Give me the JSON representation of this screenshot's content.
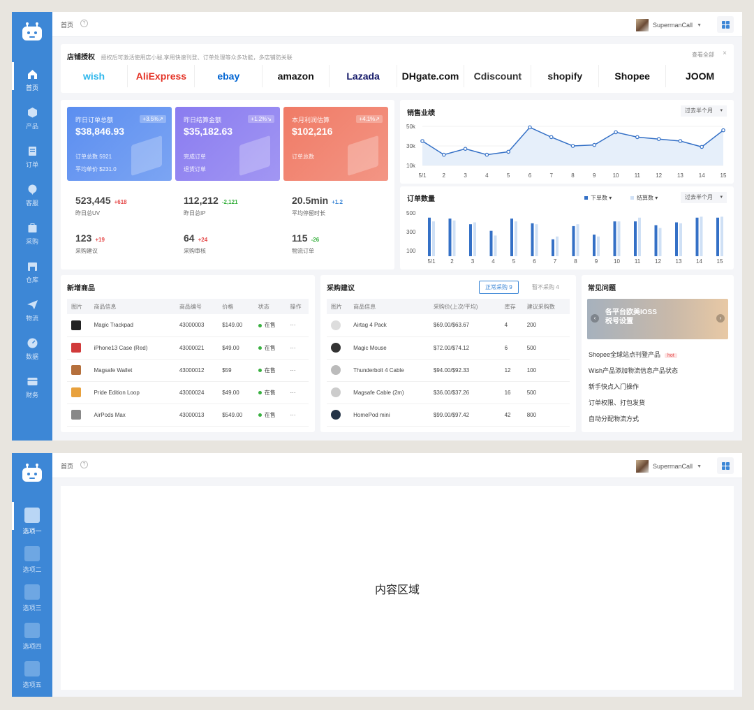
{
  "nav": [
    {
      "label": "首页",
      "icon": "home-icon"
    },
    {
      "label": "产品",
      "icon": "cube-icon"
    },
    {
      "label": "订单",
      "icon": "document-icon"
    },
    {
      "label": "客服",
      "icon": "chat-icon"
    },
    {
      "label": "采购",
      "icon": "bag-icon"
    },
    {
      "label": "仓库",
      "icon": "warehouse-icon"
    },
    {
      "label": "物流",
      "icon": "send-icon"
    },
    {
      "label": "数据",
      "icon": "gauge-icon"
    },
    {
      "label": "财务",
      "icon": "wallet-icon"
    }
  ],
  "nav2": [
    "选项一",
    "选项二",
    "选项三",
    "选项四",
    "选项五"
  ],
  "top": {
    "breadcrumb": "首页",
    "help": "?",
    "user": "SupermanCall"
  },
  "store": {
    "title": "店铺授权",
    "desc": "授权后可激活使用店小秘,享用快速刊登、订单处理等众多功能，多店铺防关联",
    "view_all": "查看全部",
    "close": "×",
    "platforms": [
      {
        "name": "wish",
        "color": "#2fb7ec"
      },
      {
        "name": "AliExpress",
        "color": "#e43225"
      },
      {
        "name": "ebay",
        "color": "#0064d2"
      },
      {
        "name": "amazon",
        "color": "#111111"
      },
      {
        "name": "Lazada",
        "color": "#101566"
      },
      {
        "name": "DHgate.com",
        "color": "#111111"
      },
      {
        "name": "Cdiscount",
        "color": "#333333"
      },
      {
        "name": "shopify",
        "color": "#222222"
      },
      {
        "name": "Shopee",
        "color": "#111111"
      },
      {
        "name": "JOOM",
        "color": "#111111"
      }
    ]
  },
  "kpis": [
    {
      "label": "昨日订单总额",
      "value": "$38,846.93",
      "badge": "+3.5%↗",
      "l1": "订单总数 5921",
      "l2": "平均单价 $231.0",
      "color": "#5b8ef0"
    },
    {
      "label": "昨日结算金额",
      "value": "$35,182.63",
      "badge": "+1.2%↘",
      "l1": "完成订单",
      "l2": "退货订单",
      "color": "#8a7cf0"
    },
    {
      "label": "本月利润估算",
      "value": "$102,216",
      "badge": "+4.1%↗",
      "l1": "订单总数",
      "l2": "",
      "color": "#f07b66"
    }
  ],
  "stats": [
    {
      "value": "523,445",
      "delta": "+618",
      "label": "昨日总UV",
      "tone": "up"
    },
    {
      "value": "112,212",
      "delta": "-2,121",
      "label": "昨日总IP",
      "tone": "down"
    },
    {
      "value": "20.5min",
      "delta": "+1.2",
      "label": "平均停留时长",
      "tone": "blue"
    },
    {
      "value": "123",
      "delta": "+19",
      "label": "采购建议",
      "tone": "up"
    },
    {
      "value": "64",
      "delta": "+24",
      "label": "采购审核",
      "tone": "up"
    },
    {
      "value": "115",
      "delta": "-26",
      "label": "物流订单",
      "tone": "down"
    }
  ],
  "sales": {
    "title": "销售业绩",
    "period": "过去半个月"
  },
  "orders": {
    "title": "订单数量",
    "period": "过去半个月",
    "legend1": "下单数",
    "legend2": "结算数"
  },
  "chart_data": [
    {
      "type": "area",
      "title": "销售业绩",
      "x": [
        "5/1",
        "2",
        "3",
        "4",
        "5",
        "6",
        "7",
        "8",
        "9",
        "10",
        "11",
        "12",
        "13",
        "14",
        "15"
      ],
      "yticks": [
        "50k",
        "30k",
        "10k"
      ],
      "ylim": [
        10000,
        50000
      ],
      "series": [
        {
          "values": [
            35000,
            21000,
            27000,
            21000,
            24000,
            49000,
            39000,
            30000,
            31000,
            44000,
            39000,
            37000,
            35000,
            29000,
            46000
          ]
        }
      ]
    },
    {
      "type": "bar",
      "title": "订单数量",
      "categories": [
        "5/1",
        "2",
        "3",
        "4",
        "5",
        "6",
        "7",
        "8",
        "9",
        "10",
        "11",
        "12",
        "13",
        "14",
        "15"
      ],
      "yticks": [
        "500",
        "300",
        "100"
      ],
      "ylim": [
        100,
        500
      ],
      "series": [
        {
          "name": "下单数",
          "values": [
            450,
            440,
            380,
            310,
            440,
            390,
            220,
            360,
            270,
            410,
            410,
            370,
            400,
            450,
            450
          ]
        },
        {
          "name": "结算数",
          "values": [
            410,
            420,
            400,
            260,
            410,
            380,
            250,
            380,
            250,
            410,
            450,
            340,
            390,
            460,
            460
          ]
        }
      ]
    }
  ],
  "newp": {
    "title": "新增商品",
    "headers": [
      "图片",
      "商品信息",
      "商品编号",
      "价格",
      "状态",
      "操作"
    ],
    "rows": [
      {
        "name": "Magic Trackpad",
        "code": "43000003",
        "price": "$149.00",
        "status": "在售",
        "op": "···",
        "thumb": "#222"
      },
      {
        "name": "iPhone13 Case (Red)",
        "code": "43000021",
        "price": "$49.00",
        "status": "在售",
        "op": "···",
        "thumb": "#d13a3a"
      },
      {
        "name": "Magsafe Wallet",
        "code": "43000012",
        "price": "$59",
        "status": "在售",
        "op": "···",
        "thumb": "#b5703c"
      },
      {
        "name": "Pride Edition Loop",
        "code": "43000024",
        "price": "$49.00",
        "status": "在售",
        "op": "···",
        "thumb": "#e8a13d"
      },
      {
        "name": "AirPods Max",
        "code": "43000013",
        "price": "$549.00",
        "status": "在售",
        "op": "···",
        "thumb": "#888"
      }
    ]
  },
  "buy": {
    "title": "采购建议",
    "tab1": "正常采购 9",
    "tab2": "暂不采购 4",
    "headers": [
      "图片",
      "商品信息",
      "采购价(上次/平均)",
      "库存",
      "建议采购数"
    ],
    "rows": [
      {
        "name": "Airtag 4 Pack",
        "price": "$69.00/$63.67",
        "stock": "4",
        "sugg": "200",
        "thumb": "#ddd"
      },
      {
        "name": "Magic Mouse",
        "price": "$72.00/$74.12",
        "stock": "6",
        "sugg": "500",
        "thumb": "#333"
      },
      {
        "name": "Thunderbolt 4 Cable",
        "price": "$94.00/$92.33",
        "stock": "12",
        "sugg": "100",
        "thumb": "#bbb"
      },
      {
        "name": "Magsafe Cable (2m)",
        "price": "$36.00/$37.26",
        "stock": "16",
        "sugg": "500",
        "thumb": "#ccc"
      },
      {
        "name": "HomePod mini",
        "price": "$99.00/$97.42",
        "stock": "42",
        "sugg": "800",
        "thumb": "#243447"
      }
    ]
  },
  "faq": {
    "title": "常见问题",
    "banner": "各平台欧美IOSS\n税号设置",
    "items": [
      "Shopee全球站点刊登产品",
      "Wish产品添加物流信息产品状态",
      "新手快点入门操作",
      "订单权限、打包发货",
      "自动分配物流方式"
    ],
    "hot": "hot"
  },
  "content": "内容区域"
}
